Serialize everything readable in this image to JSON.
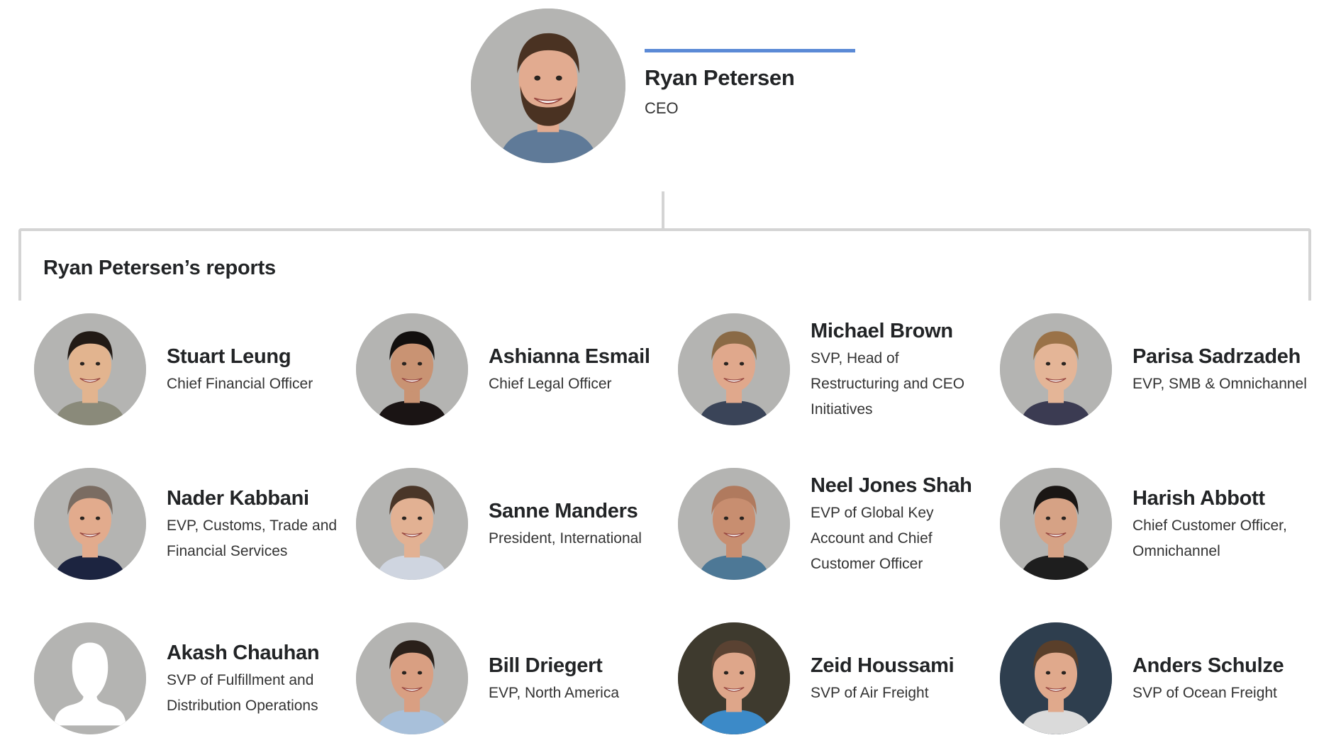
{
  "ceo": {
    "name": "Ryan Petersen",
    "title": "CEO",
    "avatar_icon": "person-photo",
    "avatar_bg": "#b4b4b2",
    "accent_color": "#5b8ad6"
  },
  "reports_section": {
    "title": "Ryan Petersen’s reports"
  },
  "reports": [
    {
      "name": "Stuart Leung",
      "title": "Chief Financial Officer",
      "avatar_bg": "#b4b4b2",
      "skin": "#e2b48f",
      "hair": "#221a15",
      "shirt": "#8a8a7a"
    },
    {
      "name": "Ashianna Esmail",
      "title": "Chief Legal Officer",
      "avatar_bg": "#b4b4b2",
      "skin": "#c99373",
      "hair": "#120f0e",
      "shirt": "#1a1414"
    },
    {
      "name": "Michael Brown",
      "title": "SVP, Head of Restructuring and CEO Initiatives",
      "avatar_bg": "#b4b4b2",
      "skin": "#e0a88c",
      "hair": "#8a6a46",
      "shirt": "#3a4458"
    },
    {
      "name": "Parisa Sadrzadeh",
      "title": "EVP, SMB & Omnichannel",
      "avatar_bg": "#b4b4b2",
      "skin": "#e4b597",
      "hair": "#9a7248",
      "shirt": "#3b3b52"
    },
    {
      "name": "Nader Kabbani",
      "title": "EVP, Customs, Trade and Financial Services",
      "avatar_bg": "#b4b4b2",
      "skin": "#e2ab8d",
      "hair": "#7a6c62",
      "shirt": "#1c2440"
    },
    {
      "name": "Sanne Manders",
      "title": "President, International",
      "avatar_bg": "#b4b4b2",
      "skin": "#e2b193",
      "hair": "#4a3628",
      "shirt": "#cfd5e0"
    },
    {
      "name": "Neel Jones Shah",
      "title": "EVP of Global Key Account and Chief Customer Officer",
      "avatar_bg": "#b4b4b2",
      "skin": "#c88e70",
      "hair": "#b07a5e",
      "shirt": "#4d7896"
    },
    {
      "name": "Harish Abbott",
      "title": "Chief Customer Officer, Omnichannel",
      "avatar_bg": "#b4b4b2",
      "skin": "#d6a285",
      "hair": "#1a1614",
      "shirt": "#1e1e1e"
    },
    {
      "name": "Akash Chauhan",
      "title": "SVP of Fulfillment and Distribution Operations",
      "avatar_bg": "#b4b4b2",
      "placeholder": true
    },
    {
      "name": "Bill Driegert",
      "title": "EVP, North America",
      "avatar_bg": "#b4b4b2",
      "skin": "#d99f82",
      "hair": "#2a201a",
      "shirt": "#a8c0da"
    },
    {
      "name": "Zeid Houssami",
      "title": "SVP of Air Freight",
      "avatar_bg": "#3e3a2e",
      "skin": "#dea68a",
      "hair": "#5a4232",
      "shirt": "#3c8ac8"
    },
    {
      "name": "Anders Schulze",
      "title": "SVP of Ocean Freight",
      "avatar_bg": "#2e3e4e",
      "skin": "#e0a98c",
      "hair": "#5a3f2a",
      "shirt": "#dadada"
    }
  ]
}
